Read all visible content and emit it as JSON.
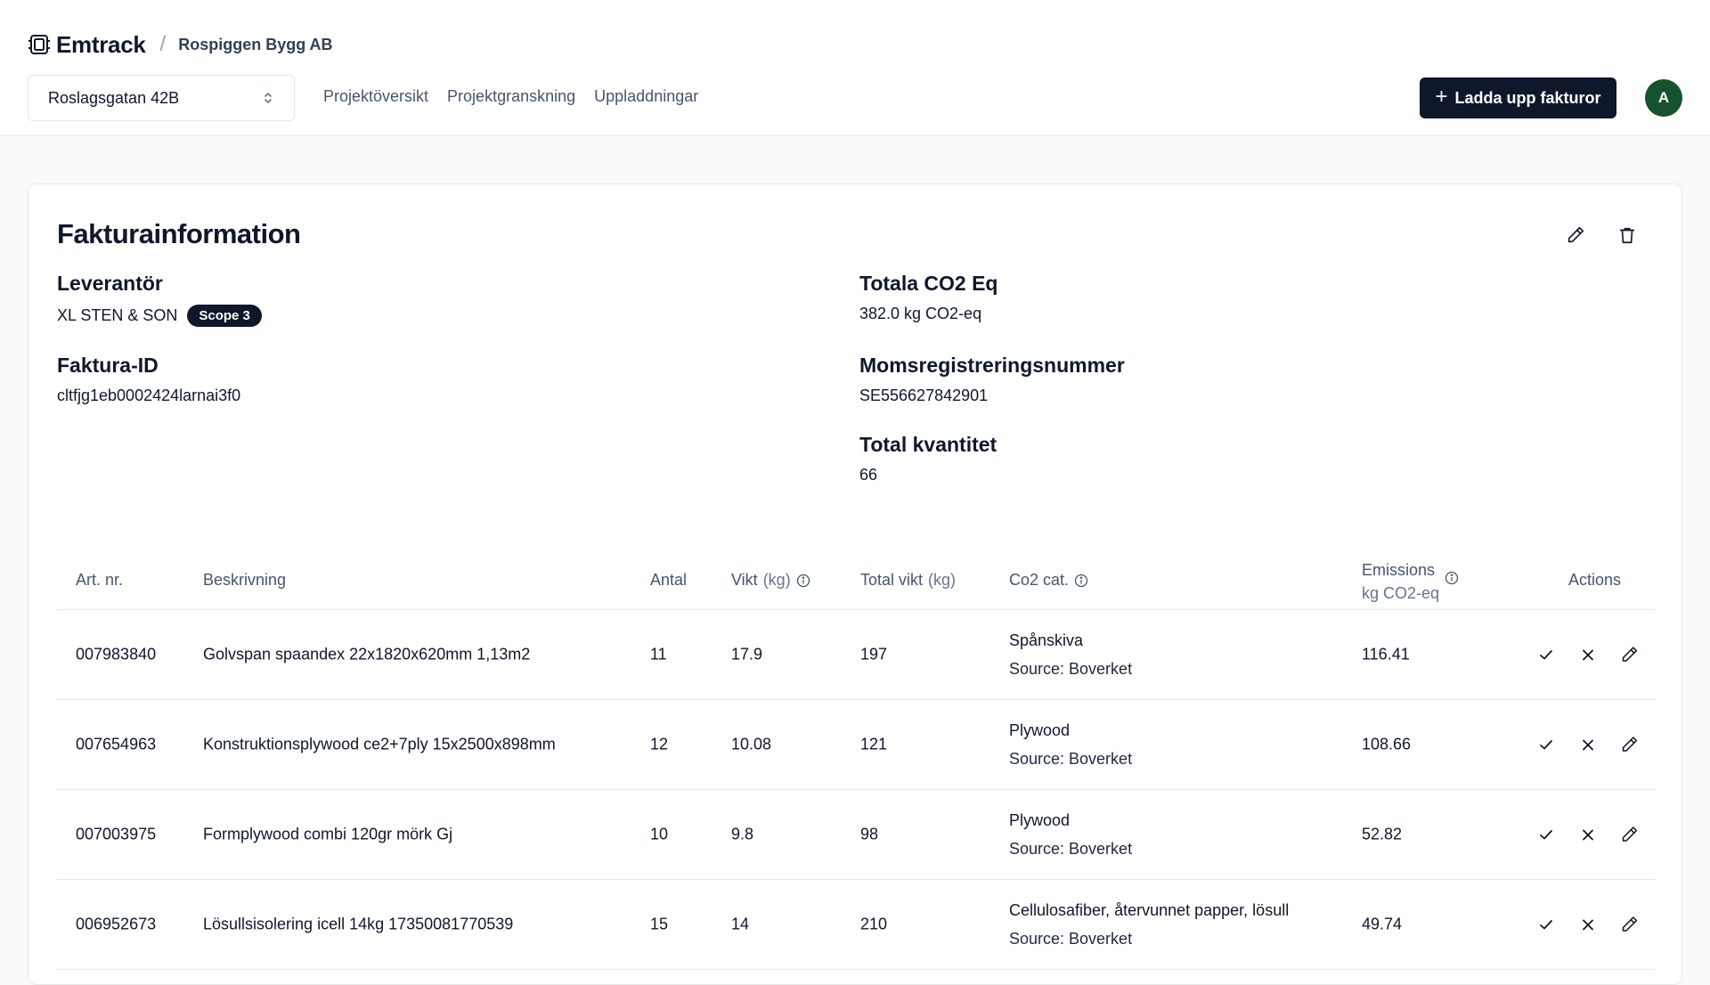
{
  "brand": {
    "name": "Emtrack",
    "separator": "/",
    "org": "Rospiggen Bygg AB"
  },
  "project_select": {
    "value": "Roslagsgatan 42B"
  },
  "nav": [
    "Projektöversikt",
    "Projektgranskning",
    "Uppladdningar"
  ],
  "upload_button": {
    "plus": "+",
    "label": "Ladda upp fakturor"
  },
  "avatar": {
    "initial": "A",
    "color": "#14532d"
  },
  "invoice": {
    "title": "Fakturainformation",
    "supplier_label": "Leverantör",
    "supplier_value": "XL STEN & SON",
    "scope_badge": "Scope 3",
    "invoice_id_label": "Faktura-ID",
    "invoice_id_value": "cltfjg1eb0002424larnai3f0",
    "total_co2_label": "Totala CO2 Eq",
    "total_co2_value": "382.0 kg CO2-eq",
    "vat_label": "Momsregistreringsnummer",
    "vat_value": "SE556627842901",
    "total_qty_label": "Total kvantitet",
    "total_qty_value": "66"
  },
  "table": {
    "headers": {
      "art_nr": "Art. nr.",
      "desc": "Beskrivning",
      "antal": "Antal",
      "vikt": "Vikt",
      "vikt_unit": "(kg)",
      "total_vikt": "Total vikt",
      "total_vikt_unit": "(kg)",
      "co2_cat": "Co2 cat.",
      "emissions": "Emissions",
      "emissions_unit": "kg CO2-eq",
      "actions": "Actions"
    },
    "rows": [
      {
        "art_nr": "007983840",
        "desc": "Golvspan spaandex 22x1820x620mm 1,13m2",
        "antal": "11",
        "vikt": "17.9",
        "total_vikt": "197",
        "cat": "Spånskiva",
        "source": "Source: Boverket",
        "emissions": "116.41"
      },
      {
        "art_nr": "007654963",
        "desc": "Konstruktionsplywood ce2+7ply 15x2500x898mm",
        "antal": "12",
        "vikt": "10.08",
        "total_vikt": "121",
        "cat": "Plywood",
        "source": "Source: Boverket",
        "emissions": "108.66"
      },
      {
        "art_nr": "007003975",
        "desc": "Formplywood combi 120gr mörk Gj",
        "antal": "10",
        "vikt": "9.8",
        "total_vikt": "98",
        "cat": "Plywood",
        "source": "Source: Boverket",
        "emissions": "52.82"
      },
      {
        "art_nr": "006952673",
        "desc": "Lösullsisolering icell 14kg 17350081770539",
        "antal": "15",
        "vikt": "14",
        "total_vikt": "210",
        "cat": "Cellulosafiber, återvunnet papper, lösull",
        "source": "Source: Boverket",
        "emissions": "49.74"
      }
    ]
  }
}
